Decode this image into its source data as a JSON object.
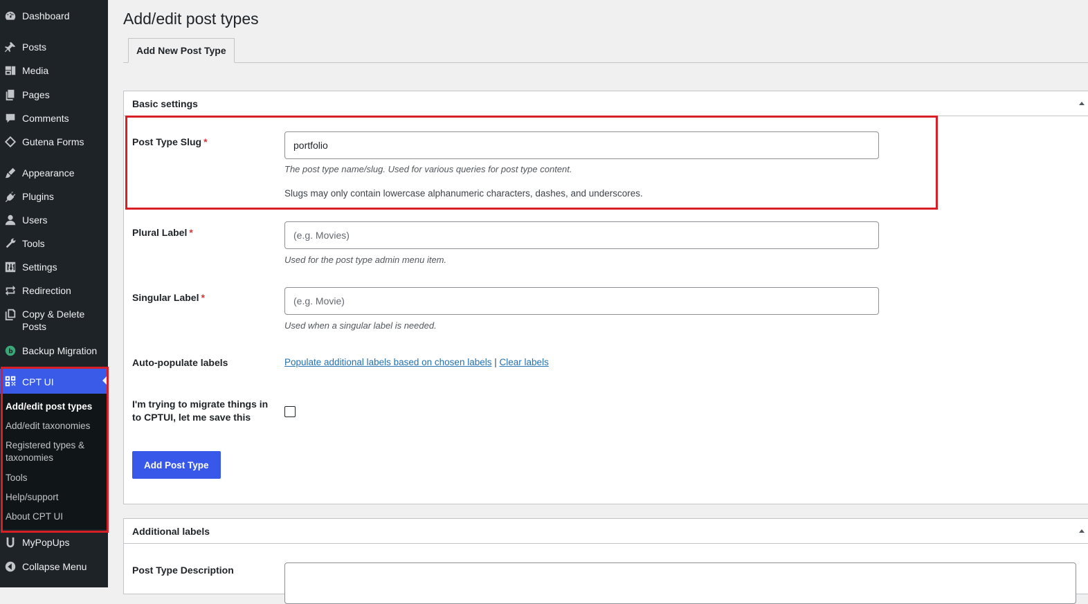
{
  "sidebar": {
    "items": [
      {
        "label": "Dashboard",
        "icon": "dashboard-icon"
      },
      {
        "label": "Posts",
        "icon": "pin-icon"
      },
      {
        "label": "Media",
        "icon": "media-icon"
      },
      {
        "label": "Pages",
        "icon": "pages-icon"
      },
      {
        "label": "Comments",
        "icon": "comment-icon"
      },
      {
        "label": "Gutena Forms",
        "icon": "diamond-icon"
      },
      {
        "label": "Appearance",
        "icon": "brush-icon"
      },
      {
        "label": "Plugins",
        "icon": "plug-icon"
      },
      {
        "label": "Users",
        "icon": "user-icon"
      },
      {
        "label": "Tools",
        "icon": "wrench-icon"
      },
      {
        "label": "Settings",
        "icon": "sliders-icon"
      },
      {
        "label": "Redirection",
        "icon": "redirect-icon"
      },
      {
        "label": "Copy & Delete Posts",
        "icon": "copy-icon"
      },
      {
        "label": "Backup Migration",
        "icon": "backup-icon"
      },
      {
        "label": "CPT UI",
        "icon": "grid-icon"
      },
      {
        "label": "MyPopUps",
        "icon": "u-icon"
      },
      {
        "label": "Collapse Menu",
        "icon": "collapse-icon"
      }
    ],
    "submenu": [
      {
        "label": "Add/edit post types",
        "current": true
      },
      {
        "label": "Add/edit taxonomies"
      },
      {
        "label": "Registered types & taxonomies"
      },
      {
        "label": "Tools"
      },
      {
        "label": "Help/support"
      },
      {
        "label": "About CPT UI"
      }
    ]
  },
  "page": {
    "title": "Add/edit post types",
    "tab": "Add New Post Type"
  },
  "basic_settings": {
    "title": "Basic settings",
    "slug": {
      "label": "Post Type Slug",
      "required": "*",
      "value": "portfolio",
      "help": "The post type name/slug. Used for various queries for post type content.",
      "note": "Slugs may only contain lowercase alphanumeric characters, dashes, and underscores."
    },
    "plural": {
      "label": "Plural Label",
      "required": "*",
      "placeholder": "(e.g. Movies)",
      "help": "Used for the post type admin menu item."
    },
    "singular": {
      "label": "Singular Label",
      "required": "*",
      "placeholder": "(e.g. Movie)",
      "help": "Used when a singular label is needed."
    },
    "auto_populate": {
      "label": "Auto-populate labels",
      "populate_link": "Populate additional labels based on chosen labels",
      "separator": "|",
      "clear_link": "Clear labels"
    },
    "migrate": {
      "label_line1": "I'm trying to migrate things in",
      "label_line2": "to CPTUI, let me save this",
      "checked": false
    },
    "submit_label": "Add Post Type"
  },
  "additional_labels": {
    "title": "Additional labels",
    "description_label": "Post Type Description"
  },
  "colors": {
    "sidebar_bg": "#1d2327",
    "active_menu": "#3a5be8",
    "primary_button": "#3858e9",
    "highlight": "#d91f26",
    "link": "#2271b1"
  }
}
